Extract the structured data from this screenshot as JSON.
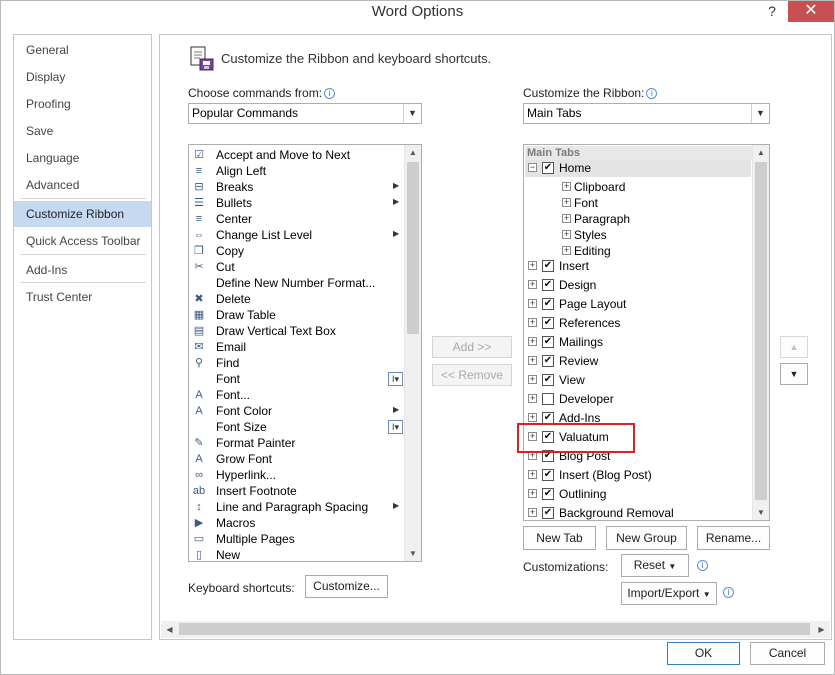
{
  "window": {
    "title": "Word Options",
    "help": "?",
    "close": "✕"
  },
  "nav": {
    "items": [
      {
        "label": "General"
      },
      {
        "label": "Display"
      },
      {
        "label": "Proofing"
      },
      {
        "label": "Save"
      },
      {
        "label": "Language"
      },
      {
        "label": "Advanced"
      },
      {
        "label": "Customize Ribbon",
        "active": true
      },
      {
        "label": "Quick Access Toolbar"
      },
      {
        "label": "Add-Ins"
      },
      {
        "label": "Trust Center"
      }
    ]
  },
  "header": {
    "text": "Customize the Ribbon and keyboard shortcuts."
  },
  "left": {
    "choose_label": "Choose commands from:",
    "choose_value": "Popular Commands",
    "commands": [
      {
        "label": "Accept and Move to Next",
        "icon": "☑"
      },
      {
        "label": "Align Left",
        "icon": "≡"
      },
      {
        "label": "Breaks",
        "icon": "⊟",
        "sub": "▶"
      },
      {
        "label": "Bullets",
        "icon": "☰",
        "sub": "▶"
      },
      {
        "label": "Center",
        "icon": "≡"
      },
      {
        "label": "Change List Level",
        "icon": "⇔",
        "sub": "▶"
      },
      {
        "label": "Copy",
        "icon": "❐"
      },
      {
        "label": "Cut",
        "icon": "✂"
      },
      {
        "label": "Define New Number Format...",
        "icon": ""
      },
      {
        "label": "Delete",
        "icon": "✖"
      },
      {
        "label": "Draw Table",
        "icon": "▦"
      },
      {
        "label": "Draw Vertical Text Box",
        "icon": "▤"
      },
      {
        "label": "Email",
        "icon": "✉"
      },
      {
        "label": "Find",
        "icon": "⚲"
      },
      {
        "label": "Font",
        "icon": "",
        "flag": "I▾"
      },
      {
        "label": "Font...",
        "icon": "A"
      },
      {
        "label": "Font Color",
        "icon": "A",
        "sub": "▶"
      },
      {
        "label": "Font Size",
        "icon": "",
        "flag": "I▾"
      },
      {
        "label": "Format Painter",
        "icon": "✎"
      },
      {
        "label": "Grow Font",
        "icon": "A"
      },
      {
        "label": "Hyperlink...",
        "icon": "∞"
      },
      {
        "label": "Insert Footnote",
        "icon": "ab"
      },
      {
        "label": "Line and Paragraph Spacing",
        "icon": "↕",
        "sub": "▶"
      },
      {
        "label": "Macros",
        "icon": "▶"
      },
      {
        "label": "Multiple Pages",
        "icon": "▭"
      },
      {
        "label": "New",
        "icon": "▯"
      }
    ],
    "keyboard_label": "Keyboard shortcuts:",
    "customize_btn": "Customize..."
  },
  "middle": {
    "add_btn": "Add >>",
    "remove_btn": "<< Remove"
  },
  "right": {
    "ribbon_label": "Customize the Ribbon:",
    "ribbon_value": "Main Tabs",
    "tree_header": "Main Tabs",
    "tree": [
      {
        "label": "Home",
        "level": 0,
        "expander": "−",
        "checked": true,
        "selected": true
      },
      {
        "label": "Clipboard",
        "level": 1,
        "expander": "+"
      },
      {
        "label": "Font",
        "level": 1,
        "expander": "+"
      },
      {
        "label": "Paragraph",
        "level": 1,
        "expander": "+"
      },
      {
        "label": "Styles",
        "level": 1,
        "expander": "+"
      },
      {
        "label": "Editing",
        "level": 1,
        "expander": "+"
      },
      {
        "label": "Insert",
        "level": 0,
        "expander": "+",
        "checked": true
      },
      {
        "label": "Design",
        "level": 0,
        "expander": "+",
        "checked": true
      },
      {
        "label": "Page Layout",
        "level": 0,
        "expander": "+",
        "checked": true
      },
      {
        "label": "References",
        "level": 0,
        "expander": "+",
        "checked": true
      },
      {
        "label": "Mailings",
        "level": 0,
        "expander": "+",
        "checked": true
      },
      {
        "label": "Review",
        "level": 0,
        "expander": "+",
        "checked": true
      },
      {
        "label": "View",
        "level": 0,
        "expander": "+",
        "checked": true
      },
      {
        "label": "Developer",
        "level": 0,
        "expander": "+",
        "checked": false
      },
      {
        "label": "Add-Ins",
        "level": 0,
        "expander": "+",
        "checked": true
      },
      {
        "label": "Valuatum",
        "level": 0,
        "expander": "+",
        "checked": true
      },
      {
        "label": "Blog Post",
        "level": 0,
        "expander": "+",
        "checked": true
      },
      {
        "label": "Insert (Blog Post)",
        "level": 0,
        "expander": "+",
        "checked": true
      },
      {
        "label": "Outlining",
        "level": 0,
        "expander": "+",
        "checked": true
      },
      {
        "label": "Background Removal",
        "level": 0,
        "expander": "+",
        "checked": true
      }
    ],
    "new_tab_btn": "New Tab",
    "new_group_btn": "New Group",
    "rename_btn": "Rename...",
    "customizations_label": "Customizations:",
    "reset_btn": "Reset",
    "import_export_btn": "Import/Export",
    "move_up": "▲",
    "move_down": "▼"
  },
  "footer": {
    "ok_btn": "OK",
    "cancel_btn": "Cancel"
  },
  "colors": {
    "nav_active": "#c5d9f1",
    "highlight": "#e02020",
    "close_btn": "#c75050"
  }
}
